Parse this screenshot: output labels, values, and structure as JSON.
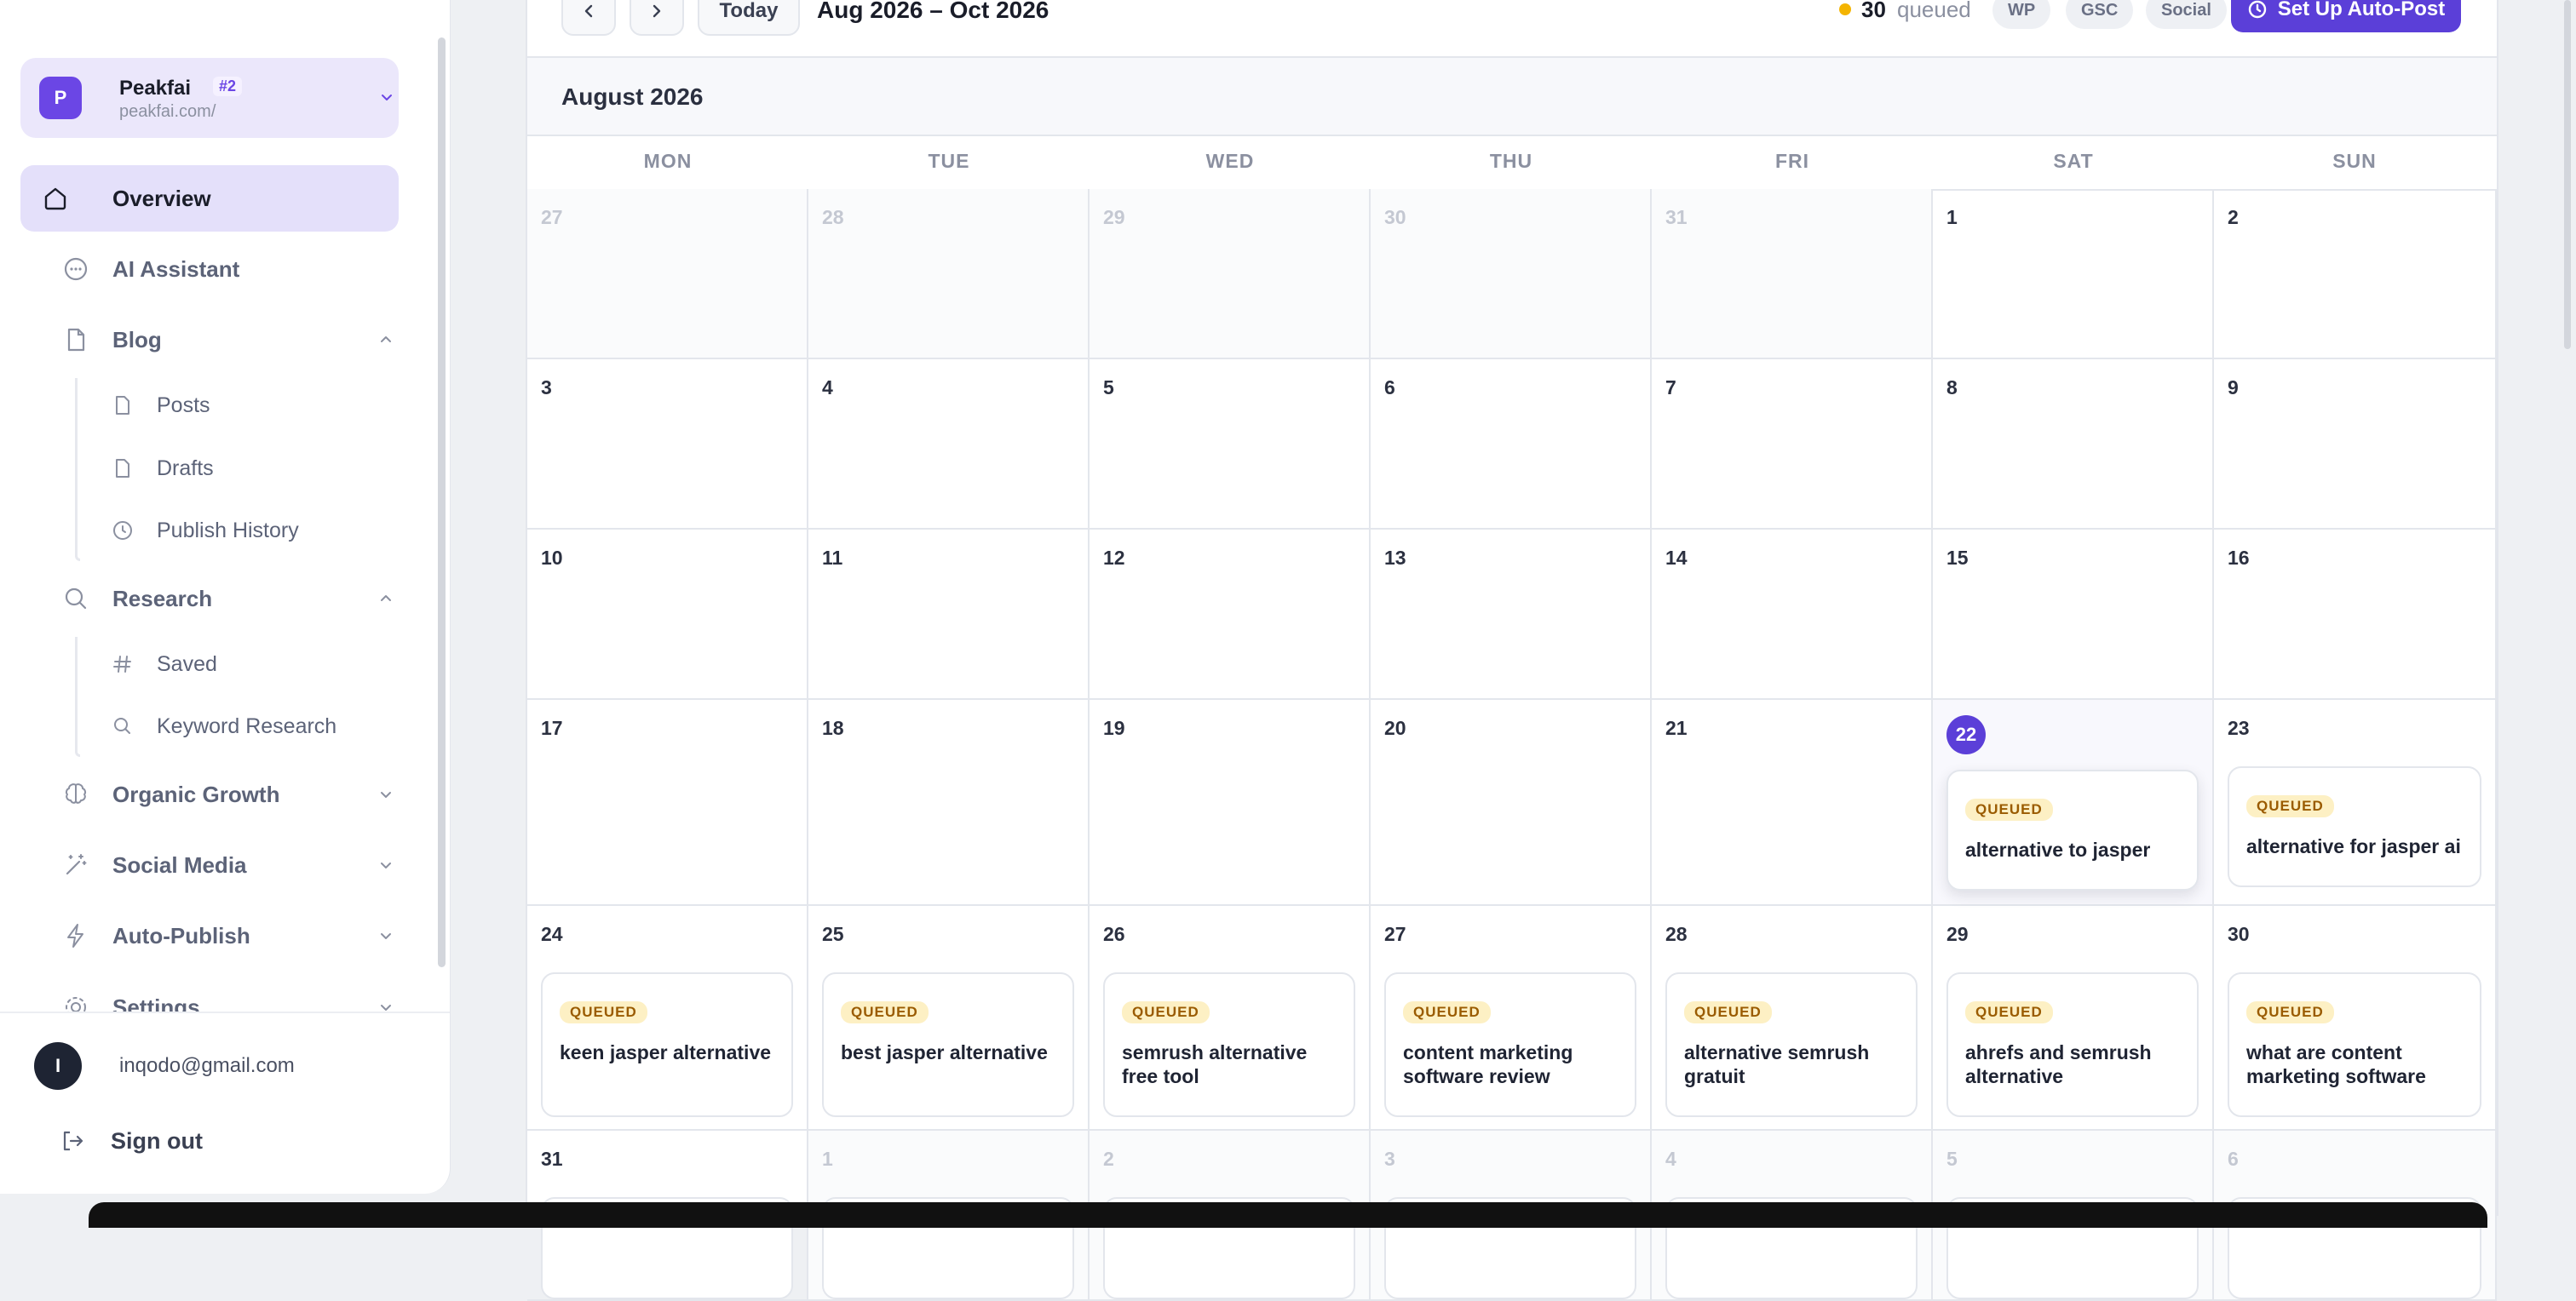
{
  "sidebar": {
    "workspace": {
      "initial": "P",
      "name": "Peakfai",
      "badge": "#2",
      "url": "peakfai.com/"
    },
    "nav": {
      "overview": "Overview",
      "ai_assistant": "AI Assistant",
      "blog": "Blog",
      "blog_items": {
        "posts": "Posts",
        "drafts": "Drafts",
        "publish_history": "Publish History"
      },
      "research": "Research",
      "research_items": {
        "saved": "Saved",
        "keyword_research": "Keyword Research"
      },
      "organic_growth": "Organic Growth",
      "social_media": "Social Media",
      "auto_publish": "Auto-Publish",
      "settings": "Settings"
    },
    "user": {
      "initial": "I",
      "email": "inqodo@gmail.com"
    },
    "sign_out": "Sign out"
  },
  "toolbar": {
    "today": "Today",
    "range": "Aug 2026 – Oct 2026",
    "queue_count": "30",
    "queue_label": "queued",
    "chips": {
      "wp": "WP",
      "gsc": "GSC",
      "social": "Social"
    },
    "autopost": "Set Up Auto-Post"
  },
  "calendar": {
    "month_title": "August 2026",
    "weekdays": {
      "mon": "MON",
      "tue": "TUE",
      "wed": "WED",
      "thu": "THU",
      "fri": "FRI",
      "sat": "SAT",
      "sun": "SUN"
    },
    "status_label": "QUEUED",
    "days": {
      "r0": [
        "27",
        "28",
        "29",
        "30",
        "31",
        "1",
        "2"
      ],
      "r1": [
        "3",
        "4",
        "5",
        "6",
        "7",
        "8",
        "9"
      ],
      "r2": [
        "10",
        "11",
        "12",
        "13",
        "14",
        "15",
        "16"
      ],
      "r3": [
        "17",
        "18",
        "19",
        "20",
        "21",
        "22",
        "23"
      ],
      "r4": [
        "24",
        "25",
        "26",
        "27",
        "28",
        "29",
        "30"
      ],
      "r5": [
        "31",
        "1",
        "2",
        "3",
        "4",
        "5",
        "6"
      ]
    },
    "events": {
      "d22": "alternative to jasper",
      "d23": "alternative for jasper ai",
      "d24": "keen jasper alternative",
      "d25": "best jasper alternative",
      "d26": "semrush alternative free tool",
      "d27": "content marketing software review",
      "d28": "alternative semrush gratuit",
      "d29": "ahrefs and semrush alternative",
      "d30": "what are content marketing software"
    }
  },
  "colors": {
    "accent": "#5b3fd8",
    "active_nav": "#e4e0fa",
    "queued_badge_bg": "#fdf0c4",
    "queued_badge_text": "#9a5b00",
    "queue_dot": "#f4b400"
  }
}
